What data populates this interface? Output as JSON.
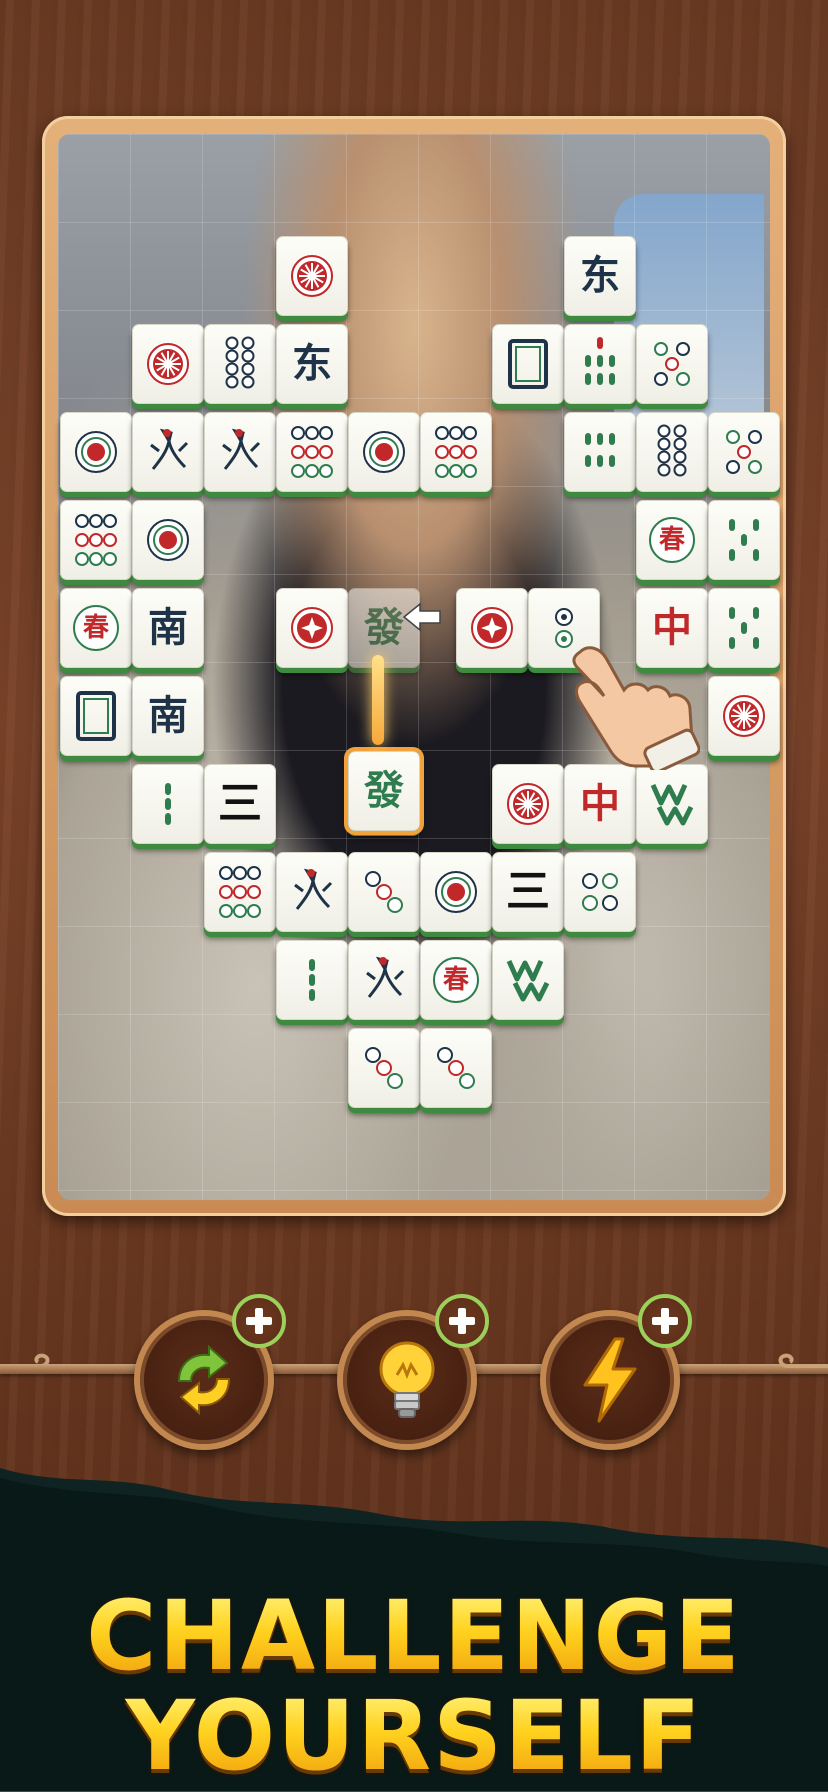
{
  "tiles": [
    {
      "col": 3,
      "row": 0,
      "glyph": "",
      "kind": "wheel"
    },
    {
      "col": 7,
      "row": 0,
      "glyph": "东",
      "kind": "char-dark"
    },
    {
      "col": 1,
      "row": 1,
      "glyph": "",
      "kind": "wheel"
    },
    {
      "col": 2,
      "row": 1,
      "glyph": "",
      "kind": "dots8"
    },
    {
      "col": 3,
      "row": 1,
      "glyph": "东",
      "kind": "char-dark"
    },
    {
      "col": 6,
      "row": 1,
      "glyph": "",
      "kind": "frame"
    },
    {
      "col": 7,
      "row": 1,
      "glyph": "",
      "kind": "bamboo7"
    },
    {
      "col": 8,
      "row": 1,
      "glyph": "",
      "kind": "circles5"
    },
    {
      "col": 0,
      "row": 2,
      "glyph": "",
      "kind": "circle1"
    },
    {
      "col": 1,
      "row": 2,
      "glyph": "",
      "kind": "bird"
    },
    {
      "col": 2,
      "row": 2,
      "glyph": "",
      "kind": "bird"
    },
    {
      "col": 3,
      "row": 2,
      "glyph": "",
      "kind": "circles9"
    },
    {
      "col": 4,
      "row": 2,
      "glyph": "",
      "kind": "circle1"
    },
    {
      "col": 5,
      "row": 2,
      "glyph": "",
      "kind": "circles9"
    },
    {
      "col": 7,
      "row": 2,
      "glyph": "",
      "kind": "bamboo6"
    },
    {
      "col": 8,
      "row": 2,
      "glyph": "",
      "kind": "dots8"
    },
    {
      "col": 9,
      "row": 2,
      "glyph": "",
      "kind": "circles5"
    },
    {
      "col": 0,
      "row": 3,
      "glyph": "",
      "kind": "circles9"
    },
    {
      "col": 1,
      "row": 3,
      "glyph": "",
      "kind": "circle1"
    },
    {
      "col": 8,
      "row": 3,
      "glyph": "春",
      "kind": "season"
    },
    {
      "col": 9,
      "row": 3,
      "glyph": "",
      "kind": "bamboo5"
    },
    {
      "col": 0,
      "row": 4,
      "glyph": "春",
      "kind": "season"
    },
    {
      "col": 1,
      "row": 4,
      "glyph": "南",
      "kind": "char-dark"
    },
    {
      "col": 3,
      "row": 4,
      "glyph": "",
      "kind": "flower"
    },
    {
      "col": 4,
      "row": 4,
      "glyph": "發",
      "kind": "char-green",
      "state": "ghost"
    },
    {
      "col": 5.5,
      "row": 4,
      "glyph": "",
      "kind": "flower"
    },
    {
      "col": 6.5,
      "row": 4,
      "glyph": "",
      "kind": "circles2"
    },
    {
      "col": 8,
      "row": 4,
      "glyph": "中",
      "kind": "char-red"
    },
    {
      "col": 9,
      "row": 4,
      "glyph": "",
      "kind": "bamboo5"
    },
    {
      "col": 0,
      "row": 5,
      "glyph": "",
      "kind": "frame"
    },
    {
      "col": 1,
      "row": 5,
      "glyph": "南",
      "kind": "char-dark"
    },
    {
      "col": 9,
      "row": 5,
      "glyph": "",
      "kind": "wheel"
    },
    {
      "col": 1,
      "row": 6,
      "glyph": "",
      "kind": "bamboo3"
    },
    {
      "col": 2,
      "row": 6,
      "glyph": "三",
      "kind": "char-black"
    },
    {
      "col": 4,
      "row": 5.85,
      "glyph": "發",
      "kind": "char-green",
      "state": "selected"
    },
    {
      "col": 6,
      "row": 6,
      "glyph": "",
      "kind": "wheel"
    },
    {
      "col": 7,
      "row": 6,
      "glyph": "中",
      "kind": "char-red"
    },
    {
      "col": 8,
      "row": 6,
      "glyph": "",
      "kind": "ww"
    },
    {
      "col": 2,
      "row": 7,
      "glyph": "",
      "kind": "circles9"
    },
    {
      "col": 3,
      "row": 7,
      "glyph": "",
      "kind": "bird"
    },
    {
      "col": 4,
      "row": 7,
      "glyph": "",
      "kind": "circles3"
    },
    {
      "col": 5,
      "row": 7,
      "glyph": "",
      "kind": "circle1"
    },
    {
      "col": 6,
      "row": 7,
      "glyph": "三",
      "kind": "char-black"
    },
    {
      "col": 7,
      "row": 7,
      "glyph": "",
      "kind": "circles4"
    },
    {
      "col": 3,
      "row": 8,
      "glyph": "",
      "kind": "bamboo3"
    },
    {
      "col": 4,
      "row": 8,
      "glyph": "",
      "kind": "bird"
    },
    {
      "col": 5,
      "row": 8,
      "glyph": "春",
      "kind": "season"
    },
    {
      "col": 6,
      "row": 8,
      "glyph": "",
      "kind": "ww"
    },
    {
      "col": 4,
      "row": 9,
      "glyph": "",
      "kind": "circles3"
    },
    {
      "col": 5,
      "row": 9,
      "glyph": "",
      "kind": "circles3"
    }
  ],
  "boosters": [
    {
      "id": "shuffle",
      "icon": "shuffle-arrows-icon"
    },
    {
      "id": "hint",
      "icon": "lightbulb-icon"
    },
    {
      "id": "lightning",
      "icon": "lightning-bolt-icon"
    }
  ],
  "headline": {
    "line1": "CHALLENGE",
    "line2": "YOURSELF"
  },
  "colors": {
    "gold": "#ffd21f",
    "tileEdge": "#3e8a3e",
    "selected": "#f2a23a",
    "plusRing": "#9bd15a"
  }
}
